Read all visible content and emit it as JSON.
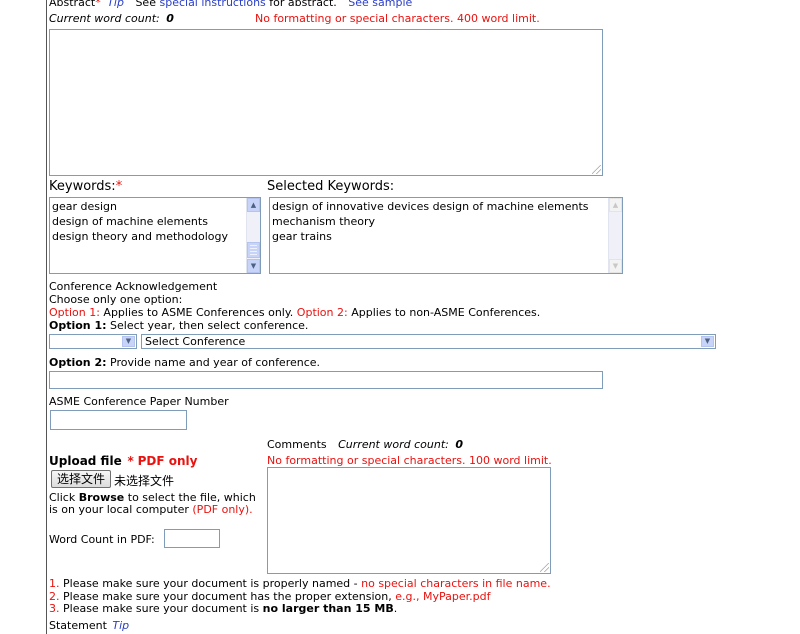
{
  "abstract": {
    "label": "Abstract",
    "req_star": "*",
    "tip": "Tip",
    "see_text": "See",
    "special_link": "special instructions",
    "for_text": "for abstract.",
    "sample_link": "See sample",
    "count_label": "Current word count:",
    "count_value": "0",
    "limit_note": "No formatting or special characters. 400 word limit.",
    "value": ""
  },
  "keywords": {
    "label": "Keywords:",
    "req_star": "*",
    "available": [
      "gear design",
      "design of machine elements",
      "design theory and methodology"
    ],
    "selected_label": "Selected Keywords:",
    "selected": [
      "design of innovative devices design of machine elements",
      "mechanism theory",
      "gear trains"
    ]
  },
  "conference": {
    "title": "Conference Acknowledgement",
    "choose": "Choose only one option:",
    "opt1_label": "Option 1:",
    "opt1_text": "Applies to ASME Conferences only.",
    "opt2_label": "Option 2:",
    "opt2_text": "Applies to non-ASME Conferences.",
    "opt1_instr_label": "Option 1:",
    "opt1_instr": "Select year, then select conference.",
    "year_value": "",
    "conf_placeholder": "Select Conference",
    "opt2_instr_label": "Option 2:",
    "opt2_instr": "Provide name and year of conference.",
    "opt2_value": "",
    "paper_number_label": "ASME Conference Paper Number",
    "paper_number_value": ""
  },
  "upload": {
    "label": "Upload file",
    "req_star": "*",
    "pdf_only": "PDF only",
    "button": "选择文件",
    "no_file": "未选择文件",
    "help_1": "Click",
    "help_browse": "Browse",
    "help_2": "to select the file, which",
    "help_3": "is on your local computer",
    "help_pdf": "(PDF only).",
    "word_count_label": "Word Count in PDF:",
    "word_count_value": ""
  },
  "comments": {
    "label": "Comments",
    "count_label": "Current word count:",
    "count_value": "0",
    "limit_note": "No formatting or special characters. 100 word limit.",
    "value": ""
  },
  "notes": {
    "n1_num": "1.",
    "n1_text": "Please make sure your document is properly named -",
    "n1_red": "no special characters in file name.",
    "n2_num": "2.",
    "n2_text": "Please make sure your document has the proper extension,",
    "n2_red": "e.g., MyPaper.pdf",
    "n3_num": "3.",
    "n3_text": "Please make sure your document is",
    "n3_bold": "no larger than 15 MB",
    "n3_end": "."
  },
  "statement": {
    "label": "Statement",
    "tip": "Tip"
  },
  "colors": {
    "red": "#e8120f",
    "link": "#2a3ec4",
    "border": "#7f9db9"
  }
}
